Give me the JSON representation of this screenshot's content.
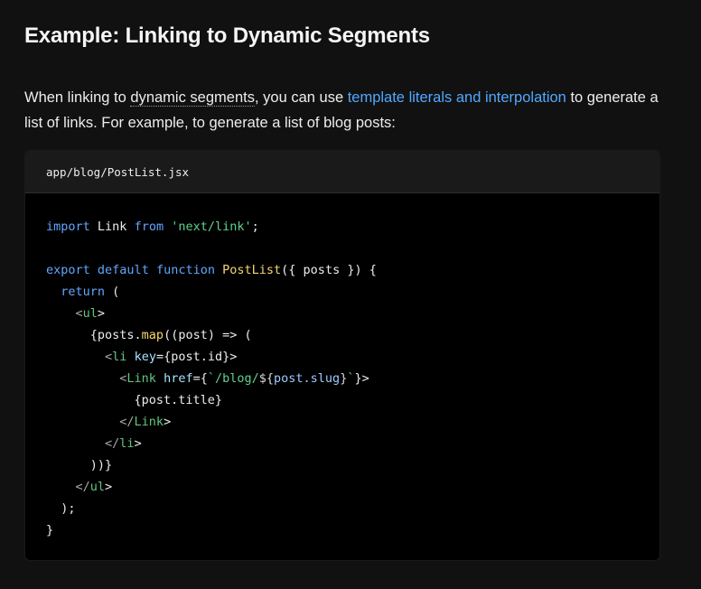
{
  "heading": "Example: Linking to Dynamic Segments",
  "paragraph": {
    "before": "When linking to ",
    "doc_link": "dynamic segments",
    "middle": ", you can use ",
    "ext_link": "template literals and interpolation",
    "after": " to generate a list of links. For example, to generate a list of blog posts:"
  },
  "code_block": {
    "filename": "app/blog/PostList.jsx",
    "lines": [
      "import Link from 'next/link';",
      "",
      "export default function PostList({ posts }) {",
      "  return (",
      "    <ul>",
      "      {posts.map((post) => (",
      "        <li key={post.id}>",
      "          <Link href={`/blog/${post.slug}`}>",
      "            {post.title}",
      "          </Link>",
      "        </li>",
      "      ))}",
      "    </ul>",
      "  );",
      "}"
    ]
  },
  "colors": {
    "background": "#111111",
    "link": "#52a8ff",
    "code_background": "#000000",
    "code_header": "#1a1a1a"
  }
}
